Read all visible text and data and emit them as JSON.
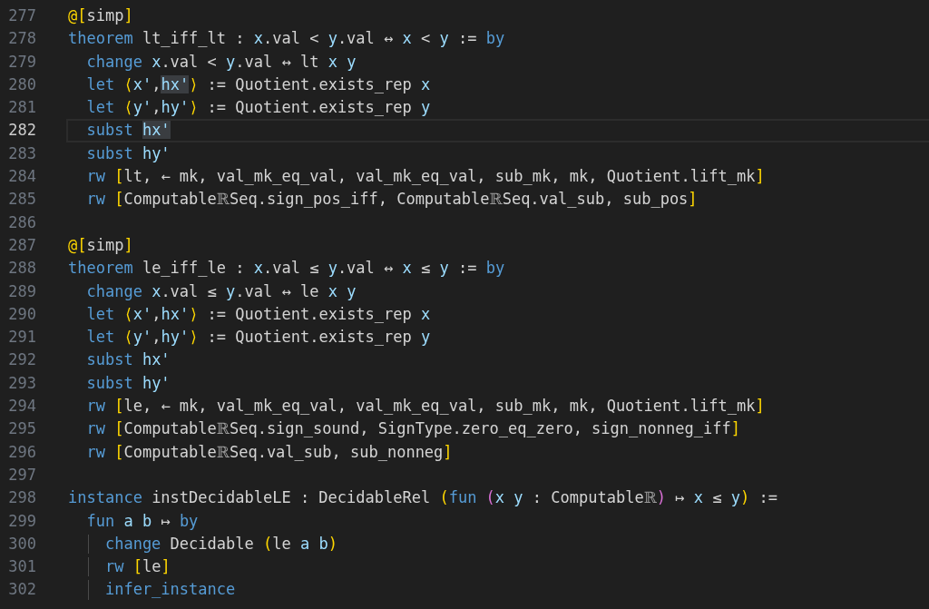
{
  "editor": {
    "lines": [
      {
        "number": "277",
        "current": false,
        "tokens": [
          {
            "text": "@[",
            "kind": "bracket"
          },
          {
            "text": "simp",
            "kind": "plain"
          },
          {
            "text": "]",
            "kind": "bracket"
          }
        ]
      },
      {
        "number": "278",
        "current": false,
        "tokens": [
          {
            "text": "theorem",
            "kind": "keyword"
          },
          {
            "text": " lt_iff_lt : ",
            "kind": "plain"
          },
          {
            "text": "x",
            "kind": "var"
          },
          {
            "text": ".val < ",
            "kind": "plain"
          },
          {
            "text": "y",
            "kind": "var"
          },
          {
            "text": ".val ↔ ",
            "kind": "plain"
          },
          {
            "text": "x",
            "kind": "var"
          },
          {
            "text": " < ",
            "kind": "plain"
          },
          {
            "text": "y",
            "kind": "var"
          },
          {
            "text": " := ",
            "kind": "plain"
          },
          {
            "text": "by",
            "kind": "keyword"
          }
        ]
      },
      {
        "number": "279",
        "current": false,
        "tokens": [
          {
            "text": "  change ",
            "kind": "keyword"
          },
          {
            "text": "x",
            "kind": "var"
          },
          {
            "text": ".val < ",
            "kind": "plain"
          },
          {
            "text": "y",
            "kind": "var"
          },
          {
            "text": ".val ↔ lt ",
            "kind": "plain"
          },
          {
            "text": "x",
            "kind": "var"
          },
          {
            "text": " y",
            "kind": "var"
          }
        ]
      },
      {
        "number": "280",
        "current": false,
        "tokens": [
          {
            "text": "  let ",
            "kind": "keyword"
          },
          {
            "text": "⟨",
            "kind": "bracket"
          },
          {
            "text": "x'",
            "kind": "var"
          },
          {
            "text": ",",
            "kind": "plain"
          },
          {
            "text": "hx'",
            "kind": "match"
          },
          {
            "text": "⟩",
            "kind": "bracket"
          },
          {
            "text": " := Quotient.exists_rep ",
            "kind": "plain"
          },
          {
            "text": "x",
            "kind": "var"
          }
        ]
      },
      {
        "number": "281",
        "current": false,
        "tokens": [
          {
            "text": "  let ",
            "kind": "keyword"
          },
          {
            "text": "⟨",
            "kind": "bracket"
          },
          {
            "text": "y'",
            "kind": "var"
          },
          {
            "text": ",",
            "kind": "plain"
          },
          {
            "text": "hy'",
            "kind": "var"
          },
          {
            "text": "⟩",
            "kind": "bracket"
          },
          {
            "text": " := Quotient.exists_rep ",
            "kind": "plain"
          },
          {
            "text": "y",
            "kind": "var"
          }
        ]
      },
      {
        "number": "282",
        "current": true,
        "tokens": [
          {
            "text": "  subst ",
            "kind": "keyword"
          },
          {
            "text": "hx'",
            "kind": "match"
          }
        ]
      },
      {
        "number": "283",
        "current": false,
        "tokens": [
          {
            "text": "  subst ",
            "kind": "keyword"
          },
          {
            "text": "hy'",
            "kind": "var"
          }
        ]
      },
      {
        "number": "284",
        "current": false,
        "tokens": [
          {
            "text": "  rw ",
            "kind": "keyword"
          },
          {
            "text": "[",
            "kind": "bracket"
          },
          {
            "text": "lt, ← mk, val_mk_eq_val, val_mk_eq_val, sub_mk, mk, Quotient.lift_mk",
            "kind": "plain"
          },
          {
            "text": "]",
            "kind": "bracket"
          }
        ]
      },
      {
        "number": "285",
        "current": false,
        "tokens": [
          {
            "text": "  rw ",
            "kind": "keyword"
          },
          {
            "text": "[",
            "kind": "bracket"
          },
          {
            "text": "Computable",
            "kind": "plain"
          },
          {
            "text": "ℝ",
            "kind": "symbol"
          },
          {
            "text": "Seq.sign_pos_iff, Computable",
            "kind": "plain"
          },
          {
            "text": "ℝ",
            "kind": "symbol"
          },
          {
            "text": "Seq.val_sub, sub_pos",
            "kind": "plain"
          },
          {
            "text": "]",
            "kind": "bracket"
          }
        ]
      },
      {
        "number": "286",
        "current": false
      },
      {
        "number": "287",
        "current": false,
        "tokens": [
          {
            "text": "@[",
            "kind": "bracket"
          },
          {
            "text": "simp",
            "kind": "plain"
          },
          {
            "text": "]",
            "kind": "bracket"
          }
        ]
      },
      {
        "number": "288",
        "current": false,
        "tokens": [
          {
            "text": "theorem",
            "kind": "keyword"
          },
          {
            "text": " le_iff_le : ",
            "kind": "plain"
          },
          {
            "text": "x",
            "kind": "var"
          },
          {
            "text": ".val ≤ ",
            "kind": "plain"
          },
          {
            "text": "y",
            "kind": "var"
          },
          {
            "text": ".val ↔ ",
            "kind": "plain"
          },
          {
            "text": "x",
            "kind": "var"
          },
          {
            "text": " ≤ ",
            "kind": "plain"
          },
          {
            "text": "y",
            "kind": "var"
          },
          {
            "text": " := ",
            "kind": "plain"
          },
          {
            "text": "by",
            "kind": "keyword"
          }
        ]
      },
      {
        "number": "289",
        "current": false,
        "tokens": [
          {
            "text": "  change ",
            "kind": "keyword"
          },
          {
            "text": "x",
            "kind": "var"
          },
          {
            "text": ".val ≤ ",
            "kind": "plain"
          },
          {
            "text": "y",
            "kind": "var"
          },
          {
            "text": ".val ↔ le ",
            "kind": "plain"
          },
          {
            "text": "x",
            "kind": "var"
          },
          {
            "text": " y",
            "kind": "var"
          }
        ]
      },
      {
        "number": "290",
        "current": false,
        "tokens": [
          {
            "text": "  let ",
            "kind": "keyword"
          },
          {
            "text": "⟨",
            "kind": "bracket"
          },
          {
            "text": "x'",
            "kind": "var"
          },
          {
            "text": ",",
            "kind": "plain"
          },
          {
            "text": "hx'",
            "kind": "var"
          },
          {
            "text": "⟩",
            "kind": "bracket"
          },
          {
            "text": " := Quotient.exists_rep ",
            "kind": "plain"
          },
          {
            "text": "x",
            "kind": "var"
          }
        ]
      },
      {
        "number": "291",
        "current": false,
        "tokens": [
          {
            "text": "  let ",
            "kind": "keyword"
          },
          {
            "text": "⟨",
            "kind": "bracket"
          },
          {
            "text": "y'",
            "kind": "var"
          },
          {
            "text": ",",
            "kind": "plain"
          },
          {
            "text": "hy'",
            "kind": "var"
          },
          {
            "text": "⟩",
            "kind": "bracket"
          },
          {
            "text": " := Quotient.exists_rep ",
            "kind": "plain"
          },
          {
            "text": "y",
            "kind": "var"
          }
        ]
      },
      {
        "number": "292",
        "current": false,
        "tokens": [
          {
            "text": "  subst ",
            "kind": "keyword"
          },
          {
            "text": "hx'",
            "kind": "var"
          }
        ]
      },
      {
        "number": "293",
        "current": false,
        "tokens": [
          {
            "text": "  subst ",
            "kind": "keyword"
          },
          {
            "text": "hy'",
            "kind": "var"
          }
        ]
      },
      {
        "number": "294",
        "current": false,
        "tokens": [
          {
            "text": "  rw ",
            "kind": "keyword"
          },
          {
            "text": "[",
            "kind": "bracket"
          },
          {
            "text": "le, ← mk, val_mk_eq_val, val_mk_eq_val, sub_mk, mk, Quotient.lift_mk",
            "kind": "plain"
          },
          {
            "text": "]",
            "kind": "bracket"
          }
        ]
      },
      {
        "number": "295",
        "current": false,
        "tokens": [
          {
            "text": "  rw ",
            "kind": "keyword"
          },
          {
            "text": "[",
            "kind": "bracket"
          },
          {
            "text": "Computable",
            "kind": "plain"
          },
          {
            "text": "ℝ",
            "kind": "symbol"
          },
          {
            "text": "Seq.sign_sound, SignType.zero_eq_zero, sign_nonneg_iff",
            "kind": "plain"
          },
          {
            "text": "]",
            "kind": "bracket"
          }
        ]
      },
      {
        "number": "296",
        "current": false,
        "tokens": [
          {
            "text": "  rw ",
            "kind": "keyword"
          },
          {
            "text": "[",
            "kind": "bracket"
          },
          {
            "text": "Computable",
            "kind": "plain"
          },
          {
            "text": "ℝ",
            "kind": "symbol"
          },
          {
            "text": "Seq.val_sub, sub_nonneg",
            "kind": "plain"
          },
          {
            "text": "]",
            "kind": "bracket"
          }
        ]
      },
      {
        "number": "297",
        "current": false
      },
      {
        "number": "298",
        "current": false,
        "tokens": [
          {
            "text": "instance",
            "kind": "keyword"
          },
          {
            "text": " instDecidableLE : DecidableRel ",
            "kind": "plain"
          },
          {
            "text": "(",
            "kind": "bracket"
          },
          {
            "text": "fun ",
            "kind": "keyword"
          },
          {
            "text": "(",
            "kind": "bracket2"
          },
          {
            "text": "x",
            "kind": "var"
          },
          {
            "text": " y",
            "kind": "var"
          },
          {
            "text": " : Computable",
            "kind": "plain"
          },
          {
            "text": "ℝ",
            "kind": "symbol"
          },
          {
            "text": ")",
            "kind": "bracket2"
          },
          {
            "text": " ↦ ",
            "kind": "plain"
          },
          {
            "text": "x",
            "kind": "var"
          },
          {
            "text": " ≤ ",
            "kind": "plain"
          },
          {
            "text": "y",
            "kind": "var"
          },
          {
            "text": ")",
            "kind": "bracket"
          },
          {
            "text": " :=",
            "kind": "plain"
          }
        ]
      },
      {
        "number": "299",
        "current": false,
        "tokens": [
          {
            "text": "  fun ",
            "kind": "keyword"
          },
          {
            "text": "a",
            "kind": "var"
          },
          {
            "text": " b",
            "kind": "var"
          },
          {
            "text": " ↦ ",
            "kind": "plain"
          },
          {
            "text": "by",
            "kind": "keyword"
          }
        ]
      },
      {
        "number": "300",
        "current": false,
        "tokens": [
          {
            "text": "    change",
            "kind": "keyword"
          },
          {
            "text": " Decidable ",
            "kind": "plain"
          },
          {
            "text": "(",
            "kind": "bracket"
          },
          {
            "text": "le ",
            "kind": "plain"
          },
          {
            "text": "a",
            "kind": "var"
          },
          {
            "text": " b",
            "kind": "var"
          },
          {
            "text": ")",
            "kind": "bracket"
          }
        ]
      },
      {
        "number": "301",
        "current": false,
        "tokens": [
          {
            "text": "    rw ",
            "kind": "keyword"
          },
          {
            "text": "[",
            "kind": "bracket"
          },
          {
            "text": "le",
            "kind": "plain"
          },
          {
            "text": "]",
            "kind": "bracket"
          }
        ]
      },
      {
        "number": "302",
        "current": false,
        "tokens": [
          {
            "text": "    infer_instance",
            "kind": "keyword"
          }
        ]
      }
    ]
  }
}
